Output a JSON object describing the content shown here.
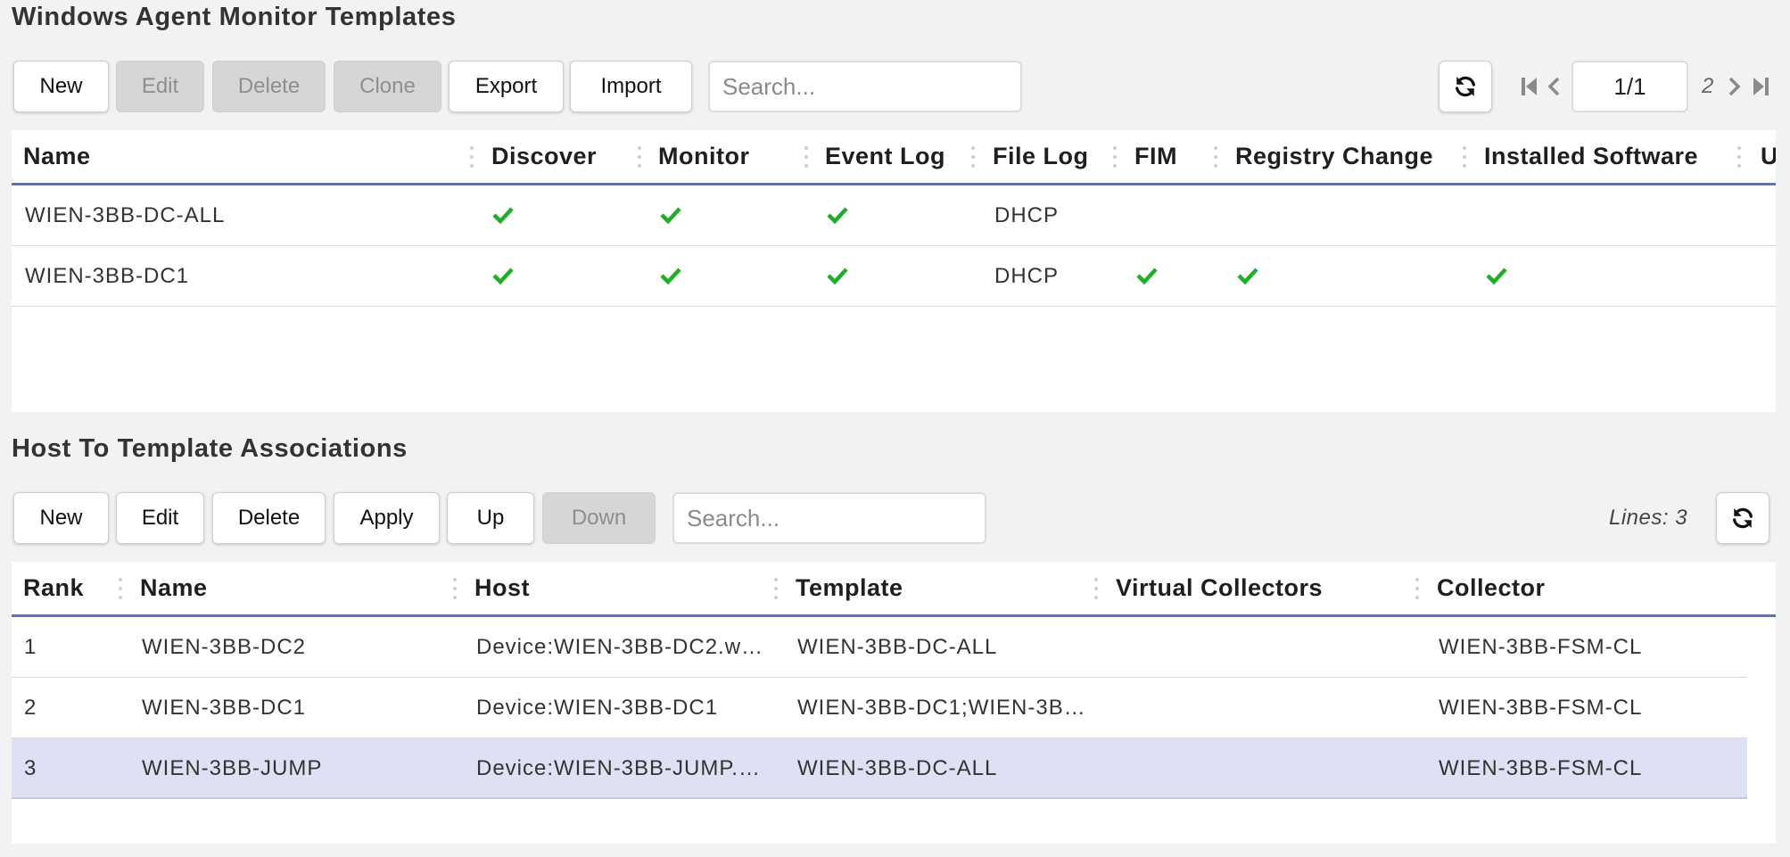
{
  "templates": {
    "title": "Windows Agent Monitor Templates",
    "toolbar": {
      "new": "New",
      "edit": "Edit",
      "delete": "Delete",
      "clone": "Clone",
      "export": "Export",
      "import": "Import",
      "search_placeholder": "Search..."
    },
    "pager": {
      "page": "1/1",
      "total": "2"
    },
    "columns": [
      "Name",
      "Discover",
      "Monitor",
      "Event Log",
      "File Log",
      "FIM",
      "Registry Change",
      "Installed Software",
      "U"
    ],
    "rows": [
      {
        "name": "WIEN-3BB-DC-ALL",
        "discover": true,
        "monitor": true,
        "event_log": true,
        "file_log": "DHCP",
        "fim": false,
        "registry_change": false,
        "installed_software": false
      },
      {
        "name": "WIEN-3BB-DC1",
        "discover": true,
        "monitor": true,
        "event_log": true,
        "file_log": "DHCP",
        "fim": true,
        "registry_change": true,
        "installed_software": true
      }
    ]
  },
  "associations": {
    "title": "Host To Template Associations",
    "toolbar": {
      "new": "New",
      "edit": "Edit",
      "delete": "Delete",
      "apply": "Apply",
      "up": "Up",
      "down": "Down",
      "search_placeholder": "Search...",
      "lines": "Lines: 3"
    },
    "columns": [
      "Rank",
      "Name",
      "Host",
      "Template",
      "Virtual Collectors",
      "Collector"
    ],
    "rows": [
      {
        "rank": "1",
        "name": "WIEN-3BB-DC2",
        "host": "Device:WIEN-3BB-DC2.w…",
        "template": "WIEN-3BB-DC-ALL",
        "virtual_collectors": "",
        "collector": "WIEN-3BB-FSM-CL",
        "selected": false
      },
      {
        "rank": "2",
        "name": "WIEN-3BB-DC1",
        "host": "Device:WIEN-3BB-DC1",
        "template": "WIEN-3BB-DC1;WIEN-3B…",
        "virtual_collectors": "",
        "collector": "WIEN-3BB-FSM-CL",
        "selected": false
      },
      {
        "rank": "3",
        "name": "WIEN-3BB-JUMP",
        "host": "Device:WIEN-3BB-JUMP.…",
        "template": "WIEN-3BB-DC-ALL",
        "virtual_collectors": "",
        "collector": "WIEN-3BB-FSM-CL",
        "selected": true
      }
    ]
  },
  "icons": {
    "refresh": "refresh-icon",
    "first_page": "first-page-icon",
    "prev_page": "prev-page-icon",
    "next_page": "next-page-icon",
    "last_page": "last-page-icon",
    "check": "check-icon",
    "column_grip": "column-resize-grip-icon"
  },
  "colors": {
    "header_underline": "#5b73b8",
    "check": "#1fae2a",
    "selected_row": "#dde1f3",
    "disabled_button": "#d6d6d6"
  }
}
